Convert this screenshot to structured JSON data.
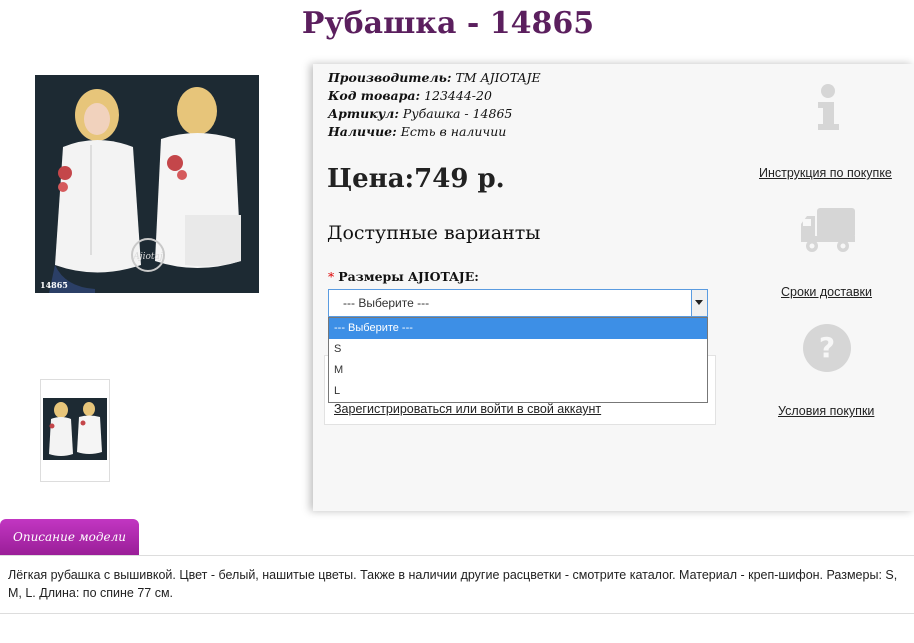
{
  "page": {
    "title": "Рубашка - 14865"
  },
  "product": {
    "photo_tag": "14865",
    "manufacturer_label": "Производитель:",
    "manufacturer_value": "ТМ AJIOTAJE",
    "code_label": "Код товара:",
    "code_value": "123444-20",
    "article_label": "Артикул:",
    "article_value": "Рубашка - 14865",
    "stock_label": "Наличие:",
    "stock_value": "Есть в наличии",
    "price": "Цена:749 р.",
    "variants_heading": "Доступные варианты"
  },
  "size_select": {
    "required_mark": "*",
    "label": "Размеры AJIOTAJE:",
    "value": "--- Выберите ---",
    "options": [
      "--- Выберите ---",
      "S",
      "M",
      "L"
    ]
  },
  "login": {
    "link": "Зарегистрироваться или войти в свой аккаунт"
  },
  "sidebar": {
    "instruction": "Инструкция по покупке",
    "delivery": "Сроки доставки",
    "conditions": "Условия покупки"
  },
  "tabs": {
    "description": "Описание модели"
  },
  "description": {
    "text": "Лёгкая рубашка с вышивкой. Цвет - белый, нашитые цветы. Также в наличии другие расцветки - смотрите каталог. Материал - креп-шифон. Размеры: S, M, L. Длина: по спине 77 см."
  },
  "colors": {
    "title": "#5b1f5e",
    "tab": "#b02bb0",
    "select_highlight": "#3d8fe6",
    "icon_gray": "#d6d6d6"
  }
}
